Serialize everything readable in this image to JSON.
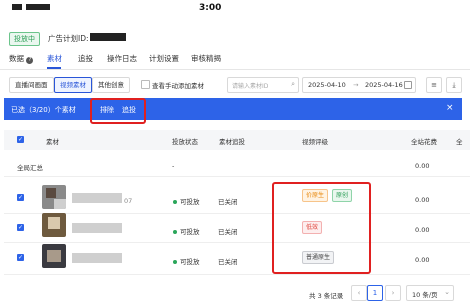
{
  "status_bar": {
    "time": "3:00"
  },
  "header": {
    "badge": "投放中",
    "plan_id_label": "广告计划ID:"
  },
  "tabs": [
    {
      "label": "数据"
    },
    {
      "label": "素材"
    },
    {
      "label": "追投"
    },
    {
      "label": "操作日志"
    },
    {
      "label": "计划设置"
    },
    {
      "label": "审核精揭"
    }
  ],
  "toolbar": {
    "buttons": [
      "直播间画面",
      "视频素材",
      "其他创意"
    ],
    "checkbox_label": "查看手动添加素材",
    "search_placeholder": "请输入素材ID",
    "date_start": "2025-04-10",
    "date_separator": "→",
    "date_end": "2025-04-16"
  },
  "selection_bar": {
    "text": "已选（3/20）个素材",
    "actions": [
      "排除",
      "追投"
    ]
  },
  "table": {
    "columns": [
      "素材",
      "投放状态",
      "素材追投",
      "视频评级",
      "全站花费",
      "全"
    ],
    "summary": {
      "label": "全局汇总",
      "status": "-",
      "cost": "0.00"
    },
    "rows": [
      {
        "id_suffix": "07",
        "status": "可投放",
        "followup": "已关闭",
        "tags": [
          {
            "text": "价原生",
            "color": "orange"
          },
          {
            "text": "原创",
            "color": "green"
          }
        ],
        "cost": "0.00"
      },
      {
        "id_suffix": "",
        "status": "可投放",
        "followup": "已关闭",
        "tags": [
          {
            "text": "低效",
            "color": "red"
          }
        ],
        "cost": "0.00"
      },
      {
        "id_suffix": "",
        "status": "可投放",
        "followup": "已关闭",
        "tags": [
          {
            "text": "普通原生",
            "color": "grey"
          }
        ],
        "cost": "0.00"
      }
    ]
  },
  "pagination": {
    "total": "共 3 条记录",
    "current_page": "1",
    "prev": "‹",
    "next": "›",
    "page_size": "10 条/页"
  },
  "colors": {
    "primary": "#2d63e8",
    "highlight": "#e02020",
    "success": "#2aa65a"
  }
}
